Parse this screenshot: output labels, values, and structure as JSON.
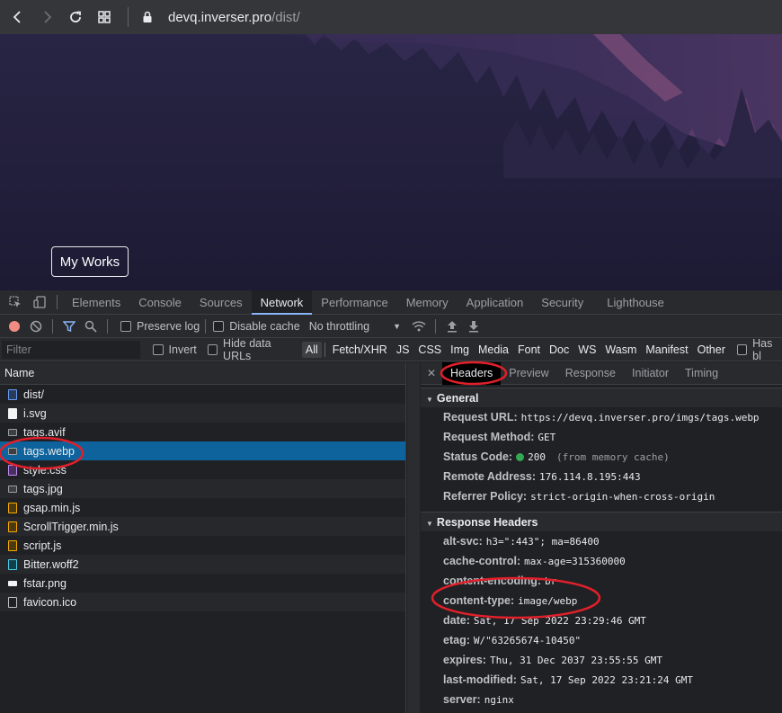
{
  "browser": {
    "url_host": "devq.inverser.pro",
    "url_path": "/dist/"
  },
  "page": {
    "works_button": "My Works"
  },
  "devtools": {
    "tabs": [
      "Elements",
      "Console",
      "Sources",
      "Network",
      "Performance",
      "Memory",
      "Application",
      "Security",
      "Lighthouse"
    ],
    "active_tab": "Network",
    "toolbar": {
      "preserve_log": "Preserve log",
      "disable_cache": "Disable cache",
      "throttling": "No throttling"
    },
    "filter": {
      "placeholder": "Filter",
      "invert": "Invert",
      "hide_data_urls": "Hide data URLs",
      "types": [
        "All",
        "Fetch/XHR",
        "JS",
        "CSS",
        "Img",
        "Media",
        "Font",
        "Doc",
        "WS",
        "Wasm",
        "Manifest",
        "Other"
      ],
      "has_blocked": "Has bl"
    },
    "requests": {
      "header": "Name",
      "items": [
        {
          "name": "dist/",
          "type": "doc"
        },
        {
          "name": "i.svg",
          "type": "svg"
        },
        {
          "name": "tags.avif",
          "type": "img"
        },
        {
          "name": "tags.webp",
          "type": "img",
          "selected": true
        },
        {
          "name": "style.css",
          "type": "css"
        },
        {
          "name": "tags.jpg",
          "type": "img"
        },
        {
          "name": "gsap.min.js",
          "type": "js"
        },
        {
          "name": "ScrollTrigger.min.js",
          "type": "js"
        },
        {
          "name": "script.js",
          "type": "js"
        },
        {
          "name": "Bitter.woff2",
          "type": "font"
        },
        {
          "name": "fstar.png",
          "type": "png"
        },
        {
          "name": "favicon.ico",
          "type": "ico"
        }
      ]
    },
    "detail": {
      "tabs": [
        "Headers",
        "Preview",
        "Response",
        "Initiator",
        "Timing"
      ],
      "active_tab": "Headers",
      "general": {
        "title": "General",
        "request_url_key": "Request URL:",
        "request_url": "https://devq.inverser.pro/imgs/tags.webp",
        "request_method_key": "Request Method:",
        "request_method": "GET",
        "status_code_key": "Status Code:",
        "status_code": "200",
        "status_note": "(from memory cache)",
        "remote_address_key": "Remote Address:",
        "remote_address": "176.114.8.195:443",
        "referrer_policy_key": "Referrer Policy:",
        "referrer_policy": "strict-origin-when-cross-origin"
      },
      "response_headers": {
        "title": "Response Headers",
        "alt_svc_key": "alt-svc:",
        "alt_svc": "h3=\":443\"; ma=86400",
        "cache_control_key": "cache-control:",
        "cache_control": "max-age=315360000",
        "content_encoding_key": "content-encoding:",
        "content_encoding": "br",
        "content_type_key": "content-type:",
        "content_type": "image/webp",
        "date_key": "date:",
        "date": "Sat, 17 Sep 2022 23:29:46 GMT",
        "etag_key": "etag:",
        "etag": "W/\"63265674-10450\"",
        "expires_key": "expires:",
        "expires": "Thu, 31 Dec 2037 23:55:55 GMT",
        "last_modified_key": "last-modified:",
        "last_modified": "Sat, 17 Sep 2022 23:21:24 GMT",
        "server_key": "server:",
        "server": "nginx"
      }
    }
  },
  "colors": {
    "accent": "#8ab4f8",
    "selected_row": "#0e639c",
    "annotation": "#e0202a",
    "status_ok": "#34a853"
  }
}
